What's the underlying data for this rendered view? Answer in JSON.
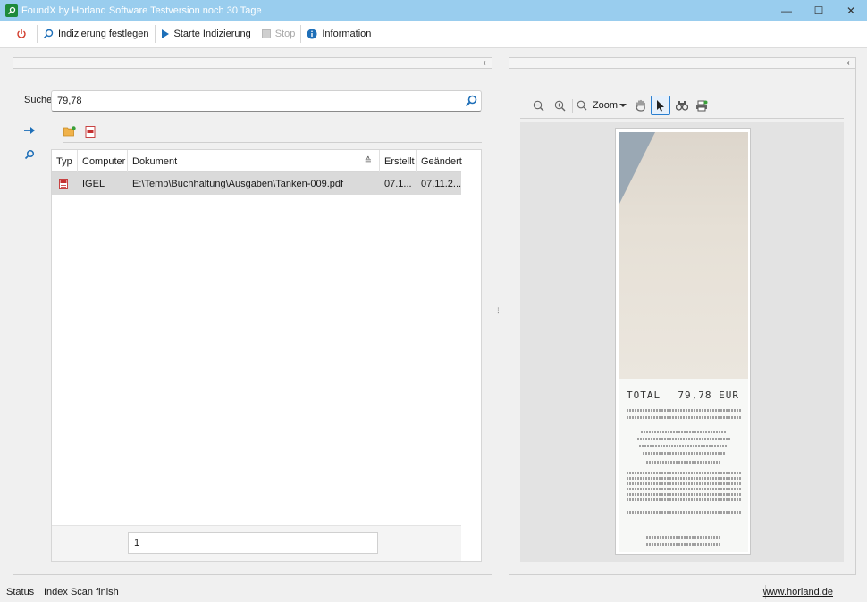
{
  "window": {
    "title": "FoundX by Horland Software Testversion noch 30 Tage",
    "controls": {
      "minimize": "—",
      "maximize": "☐",
      "close": "✕"
    }
  },
  "toolbar": {
    "power_icon": "power-icon",
    "index_settings_label": "Indizierung festlegen",
    "start_index_label": "Starte Indizierung",
    "stop_label": "Stop",
    "info_label": "Information"
  },
  "left_panel": {
    "collapse_glyph": "‹",
    "search": {
      "label": "Suche",
      "value": "79,78"
    },
    "table": {
      "columns": [
        "Typ",
        "Computer",
        "Dokument",
        "Erstellt",
        "Geändert"
      ],
      "sort_glyph": "≙",
      "rows": [
        {
          "type_icon": "pdf-icon",
          "computer": "IGEL",
          "document": "E:\\Temp\\Buchhaltung\\Ausgaben\\Tanken-009.pdf",
          "created": "07.1...",
          "modified": "07.11.2..."
        }
      ],
      "page": "1"
    }
  },
  "viewer": {
    "collapse_glyph": "‹",
    "zoom_label": "Zoom",
    "receipt": {
      "total_label": "TOTAL",
      "total_value": "79,78 EUR"
    }
  },
  "statusbar": {
    "label": "Status",
    "message": "Index Scan finish",
    "link": "www.horland.de"
  },
  "colors": {
    "titlebar": "#99cdee",
    "accent": "#1e6fb8",
    "selected_row": "#dadada"
  }
}
